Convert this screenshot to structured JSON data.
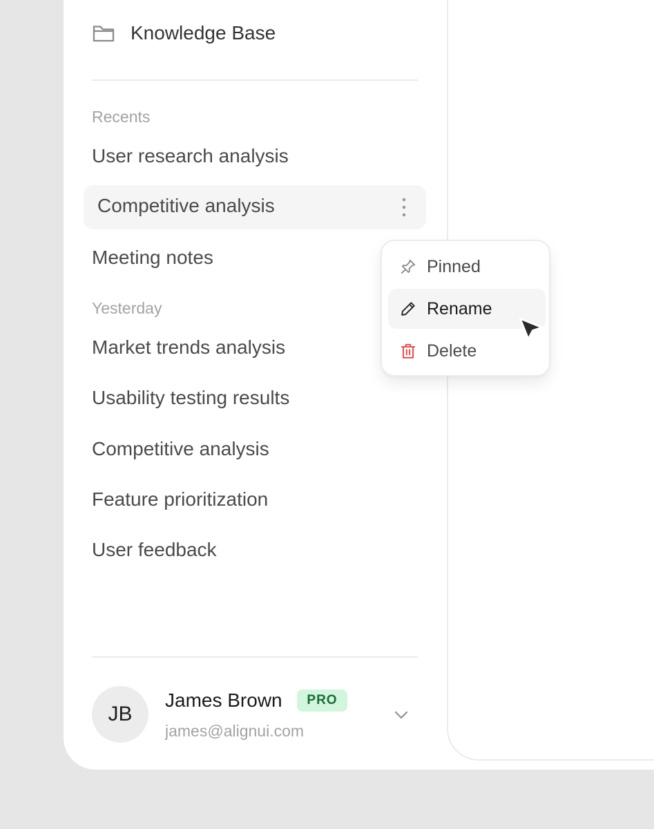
{
  "sidebar": {
    "knowledge_base": {
      "label": "Knowledge Base",
      "icon": "folder-icon"
    },
    "sections": [
      {
        "label": "Recents",
        "items": [
          {
            "label": "User research analysis"
          },
          {
            "label": "Competitive analysis",
            "active": true,
            "action_icon": "more-vertical-icon"
          },
          {
            "label": "Meeting notes"
          }
        ]
      },
      {
        "label": "Yesterday",
        "items": [
          {
            "label": "Market trends analysis"
          },
          {
            "label": "Usability testing results"
          },
          {
            "label": "Competitive analysis"
          },
          {
            "label": "Feature prioritization"
          },
          {
            "label": "User feedback"
          }
        ]
      }
    ]
  },
  "context_menu": {
    "items": [
      {
        "label": "Pinned",
        "icon": "pin-icon"
      },
      {
        "label": "Rename",
        "icon": "pencil-icon",
        "hovered": true
      },
      {
        "label": "Delete",
        "icon": "trash-icon",
        "color": "#e5484d"
      }
    ]
  },
  "profile": {
    "initials": "JB",
    "name": "James Brown",
    "badge": "PRO",
    "email": "james@alignui.com",
    "expand_icon": "chevron-down-icon"
  },
  "colors": {
    "background": "#e6e6e6",
    "panel": "#ffffff",
    "active_row": "#f5f5f5",
    "danger": "#e5484d",
    "badge_bg": "#d2f5dd",
    "badge_text": "#1a6b35"
  }
}
